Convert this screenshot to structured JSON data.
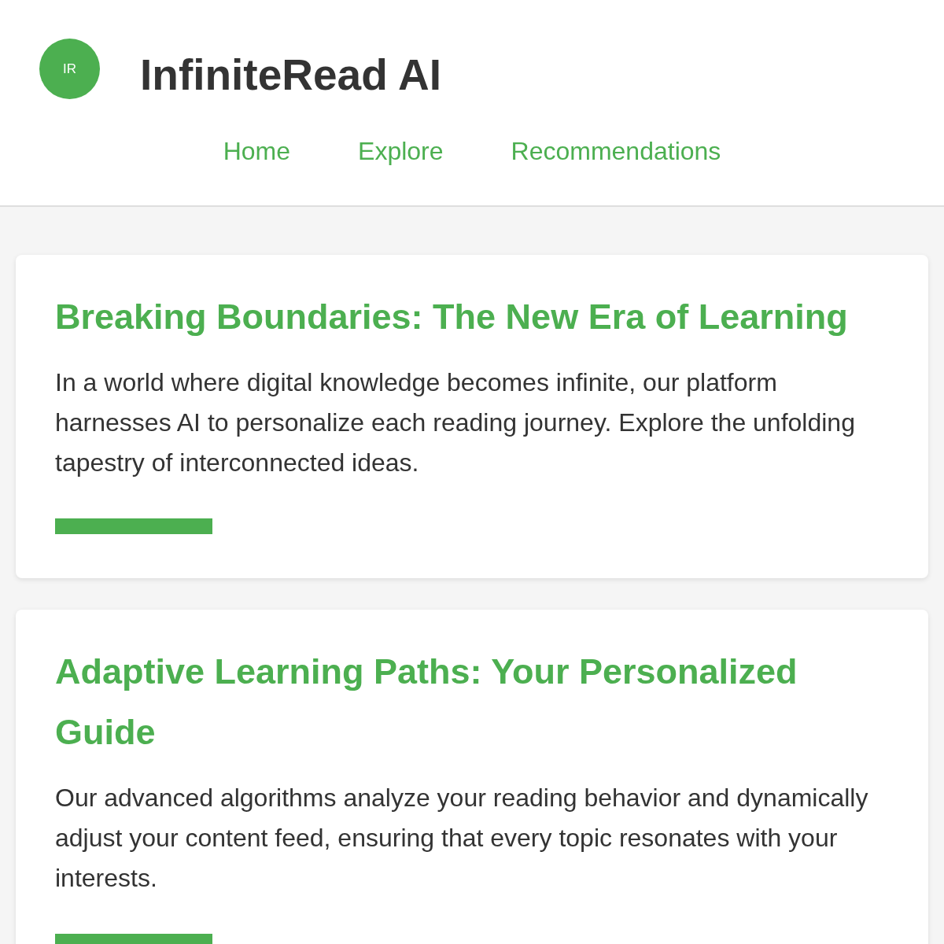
{
  "header": {
    "logo": {
      "initials": "IR"
    },
    "title": "InfiniteRead AI",
    "nav": [
      {
        "label": "Home"
      },
      {
        "label": "Explore"
      },
      {
        "label": "Recommendations"
      }
    ]
  },
  "articles": [
    {
      "title": "Breaking Boundaries: The New Era of Learning",
      "body": "In a world where digital knowledge becomes infinite, our platform harnesses AI to personalize each reading journey. Explore the unfolding tapestry of interconnected ideas."
    },
    {
      "title": "Adaptive Learning Paths: Your Personalized Guide",
      "body": "Our advanced algorithms analyze your reading behavior and dynamically adjust your content feed, ensuring that every topic resonates with your interests."
    }
  ]
}
